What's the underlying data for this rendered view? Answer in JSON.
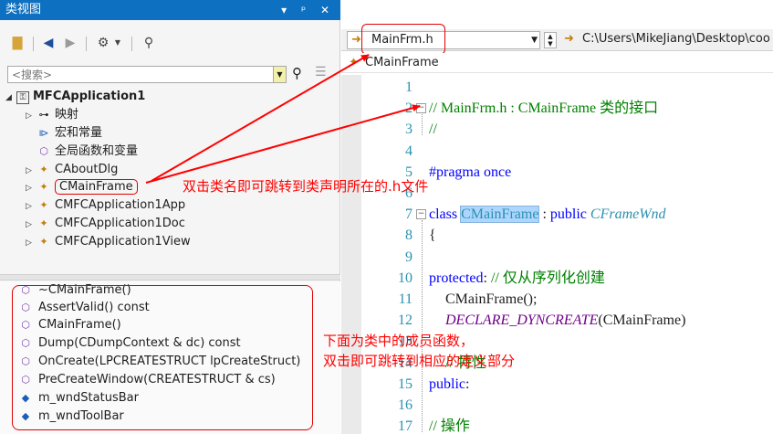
{
  "class_view": {
    "title": "类视图",
    "title_controls": [
      "▾",
      "ᵖ",
      "✕"
    ],
    "search_placeholder": "<搜索>",
    "tree": [
      {
        "label": "MFCApplication1",
        "icon": "project-icon",
        "bold": true
      },
      {
        "label": "映射",
        "icon": "map-icon"
      },
      {
        "label": "宏和常量",
        "icon": "macro-icon"
      },
      {
        "label": "全局函数和变量",
        "icon": "globals-icon"
      },
      {
        "label": "CAboutDlg",
        "icon": "class-icon"
      },
      {
        "label": "CMainFrame",
        "icon": "class-icon",
        "highlighted": true
      },
      {
        "label": "CMFCApplication1App",
        "icon": "class-icon"
      },
      {
        "label": "CMFCApplication1Doc",
        "icon": "class-icon"
      },
      {
        "label": "CMFCApplication1View",
        "icon": "class-icon"
      }
    ],
    "members": [
      {
        "label": "~CMainFrame()",
        "icon": "method-icon"
      },
      {
        "label": "AssertValid() const",
        "icon": "method-icon"
      },
      {
        "label": "CMainFrame()",
        "icon": "method-icon"
      },
      {
        "label": "Dump(CDumpContext & dc) const",
        "icon": "method-icon"
      },
      {
        "label": "OnCreate(LPCREATESTRUCT lpCreateStruct)",
        "icon": "method-icon"
      },
      {
        "label": "PreCreateWindow(CREATESTRUCT & cs)",
        "icon": "method-icon"
      },
      {
        "label": "m_wndStatusBar",
        "icon": "field-icon"
      },
      {
        "label": "m_wndToolBar",
        "icon": "field-icon"
      }
    ]
  },
  "editor": {
    "file_selector": "MainFrm.h",
    "path": "C:\\Users\\MikeJiang\\Desktop\\coo",
    "class_scope": "CMainFrame",
    "lines": [
      {
        "num": "1",
        "segments": []
      },
      {
        "num": "2",
        "fold": true,
        "segments": [
          {
            "t": "// MainFrm.h : CMainFrame 类的接口",
            "c": "c-comment"
          }
        ]
      },
      {
        "num": "3",
        "segments": [
          {
            "t": "//",
            "c": "c-comment"
          }
        ]
      },
      {
        "num": "4",
        "segments": []
      },
      {
        "num": "5",
        "segments": [
          {
            "t": "#pragma once",
            "c": "c-kw"
          }
        ]
      },
      {
        "num": "6",
        "segments": []
      },
      {
        "num": "7",
        "fold": true,
        "segments": [
          {
            "t": "class ",
            "c": "c-kw"
          },
          {
            "t": "CMainFrame",
            "c": "c-sel"
          },
          {
            "t": " : ",
            "c": ""
          },
          {
            "t": "public ",
            "c": "c-kw"
          },
          {
            "t": "CFrameWnd",
            "c": "c-type"
          }
        ]
      },
      {
        "num": "8",
        "segments": [
          {
            "t": "{",
            "c": ""
          }
        ]
      },
      {
        "num": "9",
        "segments": []
      },
      {
        "num": "10",
        "segments": [
          {
            "t": "protected",
            "c": "c-kw"
          },
          {
            "t": ": ",
            "c": ""
          },
          {
            "t": "// 仅从序列化创建",
            "c": "c-comment"
          }
        ]
      },
      {
        "num": "11",
        "indent": true,
        "segments": [
          {
            "t": "CMainFrame();",
            "c": ""
          }
        ]
      },
      {
        "num": "12",
        "indent": true,
        "segments": [
          {
            "t": "DECLARE_DYNCREATE",
            "c": "c-macro"
          },
          {
            "t": "(CMainFrame)",
            "c": ""
          }
        ]
      },
      {
        "num": "13",
        "segments": []
      },
      {
        "num": "14",
        "indent": true,
        "segments": [
          {
            "t": "// 特性",
            "c": "c-comment"
          }
        ]
      },
      {
        "num": "15",
        "segments": [
          {
            "t": "public",
            "c": "c-kw"
          },
          {
            "t": ":",
            "c": ""
          }
        ]
      },
      {
        "num": "16",
        "segments": []
      },
      {
        "num": "17",
        "segments": [
          {
            "t": "// 操作",
            "c": "c-comment"
          }
        ]
      }
    ]
  },
  "annotations": {
    "class_name_note": "双击类名即可跳转到类声明所在的.h文件",
    "members_note_1": "下面为类中的成员函数，",
    "members_note_2": "双击即可跳转到相应的定义部分"
  },
  "colors": {
    "title_bar": "#0e70c0",
    "annotation": "#ff0000",
    "comment": "#008000",
    "keyword": "#0000ff",
    "type": "#2b91af",
    "macro": "#6f008a",
    "selection": "#add6ff"
  }
}
